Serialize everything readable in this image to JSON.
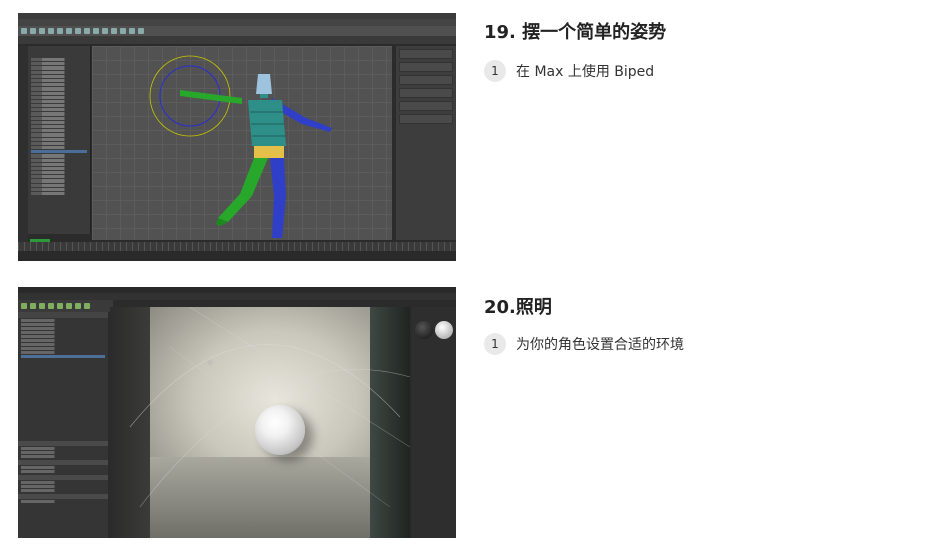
{
  "lessons": [
    {
      "title": "19. 摆一个简单的姿势",
      "steps": [
        {
          "number": "1",
          "text": "在 Max 上使用 Biped"
        }
      ]
    },
    {
      "title": "20.照明",
      "steps": [
        {
          "number": "1",
          "text": "为你的角色设置合适的环境"
        }
      ]
    }
  ],
  "colors": {
    "accent_blue": "#2f3fc8",
    "accent_green": "#27a82a",
    "bone_teal": "#2d8f88",
    "selection_yellow": "#c8c800"
  },
  "icons": {
    "light": "light-bulb-icon"
  }
}
